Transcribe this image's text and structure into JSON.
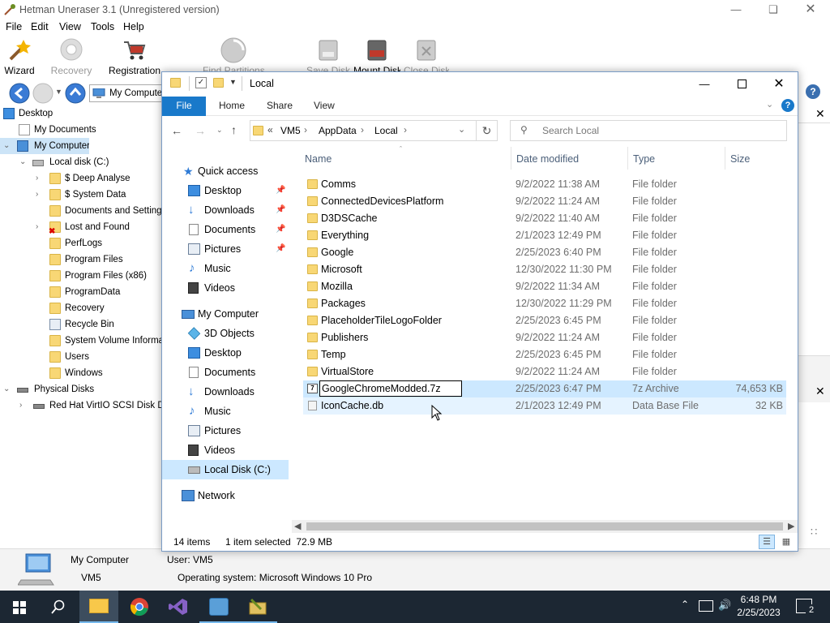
{
  "hetman": {
    "title": "Hetman Uneraser 3.1 (Unregistered version)",
    "menu": [
      "File",
      "Edit",
      "View",
      "Tools",
      "Help"
    ],
    "toolbar": {
      "wizard": "Wizard",
      "recovery": "Recovery",
      "registration": "Registration",
      "find_partitions": "Find Partitions",
      "save_disk": "Save Disk",
      "mount_disk": "Mount Disk",
      "close_disk": "Close Disk"
    },
    "nav_location": "My Computer",
    "tree": {
      "desktop": "Desktop",
      "my_documents": "My Documents",
      "my_computer": "My Computer",
      "local_disk": "Local disk (C:)",
      "deep_analyse": "$ Deep Analyse",
      "system_data": "$ System Data",
      "docs_settings": "Documents and Settings",
      "lost_found": "Lost and Found",
      "perflogs": "PerfLogs",
      "program_files": "Program Files",
      "program_files_x86": "Program Files (x86)",
      "program_data": "ProgramData",
      "recovery": "Recovery",
      "recycle_bin": "Recycle Bin",
      "system_volume": "System Volume Informat",
      "users": "Users",
      "windows": "Windows",
      "physical_disks": "Physical Disks",
      "redhat_disk": "Red Hat VirtIO SCSI Disk Dev"
    },
    "status": {
      "computer_name_label": "My Computer",
      "computer_name": "VM5",
      "user": "User: VM5",
      "os": "Operating system: Microsoft Windows 10 Pro"
    }
  },
  "explorer": {
    "title": "Local",
    "ribbon_tabs": {
      "file": "File",
      "home": "Home",
      "share": "Share",
      "view": "View"
    },
    "address": {
      "prefix": "«",
      "vm5": "VM5",
      "appdata": "AppData",
      "local": "Local"
    },
    "search_placeholder": "Search Local",
    "nav": {
      "quick_access": "Quick access",
      "desktop": "Desktop",
      "downloads": "Downloads",
      "documents": "Documents",
      "pictures": "Pictures",
      "music": "Music",
      "videos": "Videos",
      "my_computer": "My Computer",
      "objects3d": "3D Objects",
      "desktop2": "Desktop",
      "documents2": "Documents",
      "downloads2": "Downloads",
      "music2": "Music",
      "pictures2": "Pictures",
      "videos2": "Videos",
      "local_disk": "Local Disk (C:)",
      "network": "Network"
    },
    "columns": {
      "name": "Name",
      "date": "Date modified",
      "type": "Type",
      "size": "Size"
    },
    "files": [
      {
        "name": "Comms",
        "date": "9/2/2022 11:38 AM",
        "type": "File folder",
        "size": ""
      },
      {
        "name": "ConnectedDevicesPlatform",
        "date": "9/2/2022 11:24 AM",
        "type": "File folder",
        "size": ""
      },
      {
        "name": "D3DSCache",
        "date": "9/2/2022 11:40 AM",
        "type": "File folder",
        "size": ""
      },
      {
        "name": "Everything",
        "date": "2/1/2023 12:49 PM",
        "type": "File folder",
        "size": ""
      },
      {
        "name": "Google",
        "date": "2/25/2023 6:40 PM",
        "type": "File folder",
        "size": ""
      },
      {
        "name": "Microsoft",
        "date": "12/30/2022 11:30 PM",
        "type": "File folder",
        "size": ""
      },
      {
        "name": "Mozilla",
        "date": "9/2/2022 11:34 AM",
        "type": "File folder",
        "size": ""
      },
      {
        "name": "Packages",
        "date": "12/30/2022 11:29 PM",
        "type": "File folder",
        "size": ""
      },
      {
        "name": "PlaceholderTileLogoFolder",
        "date": "2/25/2023 6:45 PM",
        "type": "File folder",
        "size": ""
      },
      {
        "name": "Publishers",
        "date": "9/2/2022 11:24 AM",
        "type": "File folder",
        "size": ""
      },
      {
        "name": "Temp",
        "date": "2/25/2023 6:45 PM",
        "type": "File folder",
        "size": ""
      },
      {
        "name": "VirtualStore",
        "date": "9/2/2022 11:24 AM",
        "type": "File folder",
        "size": ""
      },
      {
        "name": "GoogleChromeModded.7z",
        "date": "2/25/2023 6:47 PM",
        "type": "7z Archive",
        "size": "74,653 KB"
      },
      {
        "name": "IconCache.db",
        "date": "2/1/2023 12:49 PM",
        "type": "Data Base File",
        "size": "32 KB"
      }
    ],
    "status": {
      "items": "14 items",
      "selected": "1 item selected  72.9 MB"
    }
  },
  "taskbar": {
    "time": "6:48 PM",
    "date": "2/25/2023",
    "notification_count": "2"
  },
  "colors": {
    "accent": "#1979ca",
    "selection": "#cce8ff",
    "folder": "#f8d775",
    "taskbar": "#1c2733"
  }
}
